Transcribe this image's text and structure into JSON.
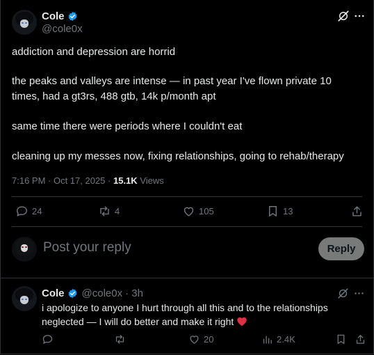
{
  "post": {
    "author_name": "Cole",
    "author_handle": "@cole0x",
    "lines": [
      "addiction and depression are horrid",
      "the peaks and valleys are intense — in past year I've flown private 10",
      "times, had a gt3rs, 488 gtb, 14k p/month apt",
      "same time there were periods where I couldn't eat",
      "cleaning up my messes now, fixing relationships, going to rehab/therapy"
    ],
    "timestamp": "7:16 PM · Oct 17, 2025 ·",
    "views_count": "15.1K",
    "views_label": "Views",
    "stats": {
      "replies": "24",
      "reposts": "4",
      "likes": "105",
      "bookmarks": "13"
    }
  },
  "compose": {
    "placeholder": "Post your reply",
    "reply_button": "Reply"
  },
  "reply": {
    "author_name": "Cole",
    "author_handle": "@cole0x",
    "time": "· 3h",
    "line1": "i apologize to anyone I hurt through all this and to the relationships",
    "line2": "neglected — I will do better and make it right",
    "stats": {
      "likes": "20",
      "views": "2.4K"
    }
  },
  "colors": {
    "background": "#000000",
    "text": "#e7e9ea",
    "muted": "#71767b",
    "verified": "#1d9bf0",
    "heart": "#f91880"
  }
}
